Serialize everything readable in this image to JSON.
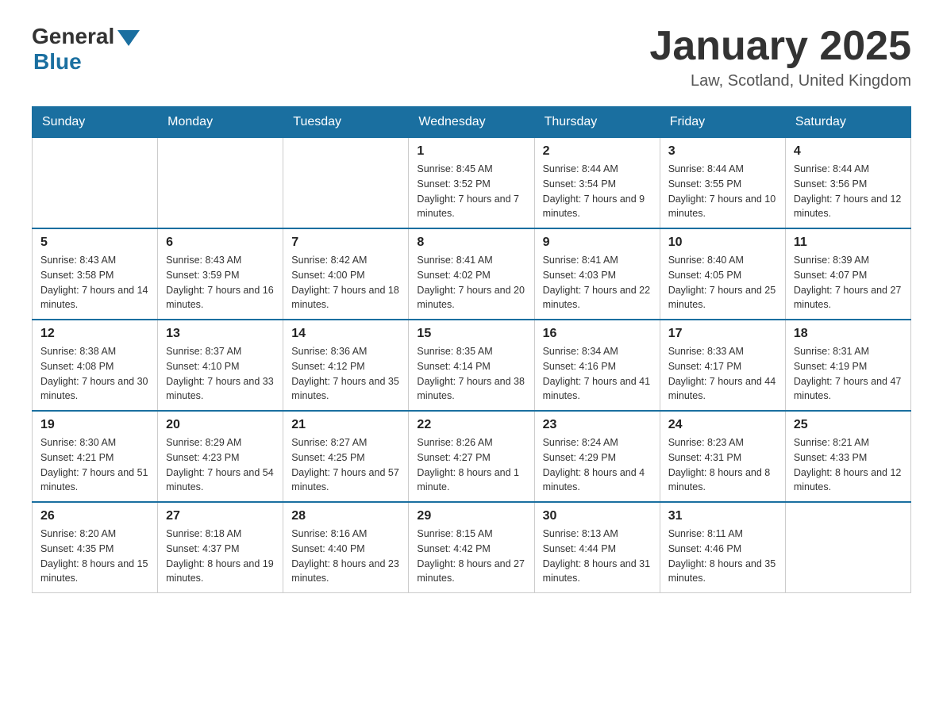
{
  "header": {
    "logo_general": "General",
    "logo_blue": "Blue",
    "month_title": "January 2025",
    "location": "Law, Scotland, United Kingdom"
  },
  "days_of_week": [
    "Sunday",
    "Monday",
    "Tuesday",
    "Wednesday",
    "Thursday",
    "Friday",
    "Saturday"
  ],
  "weeks": [
    [
      {
        "day": "",
        "sunrise": "",
        "sunset": "",
        "daylight": ""
      },
      {
        "day": "",
        "sunrise": "",
        "sunset": "",
        "daylight": ""
      },
      {
        "day": "",
        "sunrise": "",
        "sunset": "",
        "daylight": ""
      },
      {
        "day": "1",
        "sunrise": "Sunrise: 8:45 AM",
        "sunset": "Sunset: 3:52 PM",
        "daylight": "Daylight: 7 hours and 7 minutes."
      },
      {
        "day": "2",
        "sunrise": "Sunrise: 8:44 AM",
        "sunset": "Sunset: 3:54 PM",
        "daylight": "Daylight: 7 hours and 9 minutes."
      },
      {
        "day": "3",
        "sunrise": "Sunrise: 8:44 AM",
        "sunset": "Sunset: 3:55 PM",
        "daylight": "Daylight: 7 hours and 10 minutes."
      },
      {
        "day": "4",
        "sunrise": "Sunrise: 8:44 AM",
        "sunset": "Sunset: 3:56 PM",
        "daylight": "Daylight: 7 hours and 12 minutes."
      }
    ],
    [
      {
        "day": "5",
        "sunrise": "Sunrise: 8:43 AM",
        "sunset": "Sunset: 3:58 PM",
        "daylight": "Daylight: 7 hours and 14 minutes."
      },
      {
        "day": "6",
        "sunrise": "Sunrise: 8:43 AM",
        "sunset": "Sunset: 3:59 PM",
        "daylight": "Daylight: 7 hours and 16 minutes."
      },
      {
        "day": "7",
        "sunrise": "Sunrise: 8:42 AM",
        "sunset": "Sunset: 4:00 PM",
        "daylight": "Daylight: 7 hours and 18 minutes."
      },
      {
        "day": "8",
        "sunrise": "Sunrise: 8:41 AM",
        "sunset": "Sunset: 4:02 PM",
        "daylight": "Daylight: 7 hours and 20 minutes."
      },
      {
        "day": "9",
        "sunrise": "Sunrise: 8:41 AM",
        "sunset": "Sunset: 4:03 PM",
        "daylight": "Daylight: 7 hours and 22 minutes."
      },
      {
        "day": "10",
        "sunrise": "Sunrise: 8:40 AM",
        "sunset": "Sunset: 4:05 PM",
        "daylight": "Daylight: 7 hours and 25 minutes."
      },
      {
        "day": "11",
        "sunrise": "Sunrise: 8:39 AM",
        "sunset": "Sunset: 4:07 PM",
        "daylight": "Daylight: 7 hours and 27 minutes."
      }
    ],
    [
      {
        "day": "12",
        "sunrise": "Sunrise: 8:38 AM",
        "sunset": "Sunset: 4:08 PM",
        "daylight": "Daylight: 7 hours and 30 minutes."
      },
      {
        "day": "13",
        "sunrise": "Sunrise: 8:37 AM",
        "sunset": "Sunset: 4:10 PM",
        "daylight": "Daylight: 7 hours and 33 minutes."
      },
      {
        "day": "14",
        "sunrise": "Sunrise: 8:36 AM",
        "sunset": "Sunset: 4:12 PM",
        "daylight": "Daylight: 7 hours and 35 minutes."
      },
      {
        "day": "15",
        "sunrise": "Sunrise: 8:35 AM",
        "sunset": "Sunset: 4:14 PM",
        "daylight": "Daylight: 7 hours and 38 minutes."
      },
      {
        "day": "16",
        "sunrise": "Sunrise: 8:34 AM",
        "sunset": "Sunset: 4:16 PM",
        "daylight": "Daylight: 7 hours and 41 minutes."
      },
      {
        "day": "17",
        "sunrise": "Sunrise: 8:33 AM",
        "sunset": "Sunset: 4:17 PM",
        "daylight": "Daylight: 7 hours and 44 minutes."
      },
      {
        "day": "18",
        "sunrise": "Sunrise: 8:31 AM",
        "sunset": "Sunset: 4:19 PM",
        "daylight": "Daylight: 7 hours and 47 minutes."
      }
    ],
    [
      {
        "day": "19",
        "sunrise": "Sunrise: 8:30 AM",
        "sunset": "Sunset: 4:21 PM",
        "daylight": "Daylight: 7 hours and 51 minutes."
      },
      {
        "day": "20",
        "sunrise": "Sunrise: 8:29 AM",
        "sunset": "Sunset: 4:23 PM",
        "daylight": "Daylight: 7 hours and 54 minutes."
      },
      {
        "day": "21",
        "sunrise": "Sunrise: 8:27 AM",
        "sunset": "Sunset: 4:25 PM",
        "daylight": "Daylight: 7 hours and 57 minutes."
      },
      {
        "day": "22",
        "sunrise": "Sunrise: 8:26 AM",
        "sunset": "Sunset: 4:27 PM",
        "daylight": "Daylight: 8 hours and 1 minute."
      },
      {
        "day": "23",
        "sunrise": "Sunrise: 8:24 AM",
        "sunset": "Sunset: 4:29 PM",
        "daylight": "Daylight: 8 hours and 4 minutes."
      },
      {
        "day": "24",
        "sunrise": "Sunrise: 8:23 AM",
        "sunset": "Sunset: 4:31 PM",
        "daylight": "Daylight: 8 hours and 8 minutes."
      },
      {
        "day": "25",
        "sunrise": "Sunrise: 8:21 AM",
        "sunset": "Sunset: 4:33 PM",
        "daylight": "Daylight: 8 hours and 12 minutes."
      }
    ],
    [
      {
        "day": "26",
        "sunrise": "Sunrise: 8:20 AM",
        "sunset": "Sunset: 4:35 PM",
        "daylight": "Daylight: 8 hours and 15 minutes."
      },
      {
        "day": "27",
        "sunrise": "Sunrise: 8:18 AM",
        "sunset": "Sunset: 4:37 PM",
        "daylight": "Daylight: 8 hours and 19 minutes."
      },
      {
        "day": "28",
        "sunrise": "Sunrise: 8:16 AM",
        "sunset": "Sunset: 4:40 PM",
        "daylight": "Daylight: 8 hours and 23 minutes."
      },
      {
        "day": "29",
        "sunrise": "Sunrise: 8:15 AM",
        "sunset": "Sunset: 4:42 PM",
        "daylight": "Daylight: 8 hours and 27 minutes."
      },
      {
        "day": "30",
        "sunrise": "Sunrise: 8:13 AM",
        "sunset": "Sunset: 4:44 PM",
        "daylight": "Daylight: 8 hours and 31 minutes."
      },
      {
        "day": "31",
        "sunrise": "Sunrise: 8:11 AM",
        "sunset": "Sunset: 4:46 PM",
        "daylight": "Daylight: 8 hours and 35 minutes."
      },
      {
        "day": "",
        "sunrise": "",
        "sunset": "",
        "daylight": ""
      }
    ]
  ]
}
